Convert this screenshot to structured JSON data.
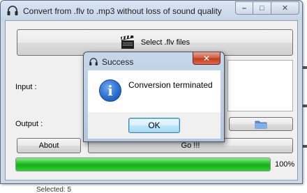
{
  "main_window": {
    "title": "Convert from .flv to .mp3 without loss of sound quality",
    "caption_buttons": {
      "minimize": "–",
      "maximize": "□",
      "close": "✕"
    },
    "select_button_label": "Select .flv files",
    "input_label": "Input :",
    "output_label": "Output :",
    "about_button_label": "About",
    "go_button_label": "Go !!!",
    "progress": {
      "value_percent": 100,
      "label": "100%",
      "color": "#1ebd1e"
    }
  },
  "dialog": {
    "title": "Success",
    "close_button": "✕",
    "message": "Conversion terminated",
    "ok_button_label": "OK",
    "icon": "info-icon"
  },
  "background": {
    "bottom_text": "Selected: 5"
  }
}
